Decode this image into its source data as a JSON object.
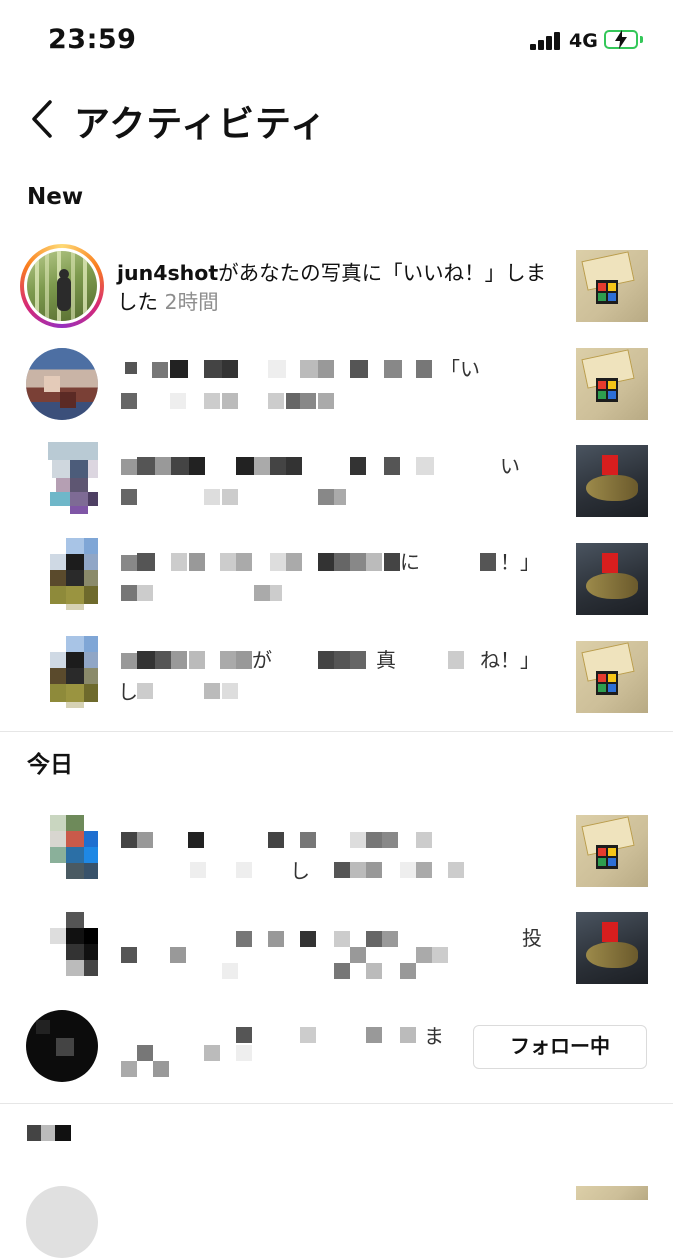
{
  "status_bar": {
    "time": "23:59",
    "network": "4G",
    "icons": [
      "cellular-signal-icon",
      "battery-charging-icon"
    ],
    "battery_color": "#34c759"
  },
  "header": {
    "back_icon": "chevron-left-icon",
    "title": "アクティビティ"
  },
  "sections": {
    "new": "New",
    "today": "今日"
  },
  "notifications": [
    {
      "user": "jun4shot",
      "message": "があなたの写真に「いいね！」しました",
      "time": "2時間"
    }
  ],
  "buttons": {
    "following": "フォロー中"
  },
  "colors": {
    "story_ring": [
      "#feda75",
      "#fa7e1e",
      "#d62976",
      "#962fbf"
    ],
    "secondary_text": "#8e8e8e",
    "divider": "#e6e6e6"
  }
}
